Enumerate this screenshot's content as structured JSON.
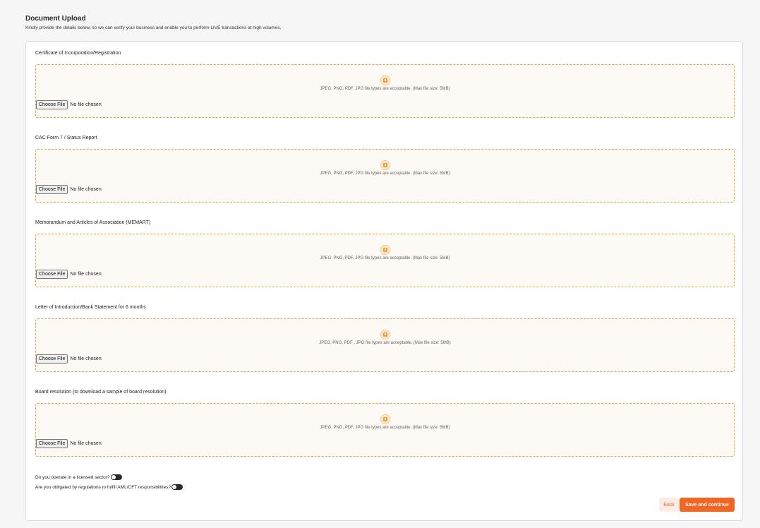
{
  "header": {
    "title": "Document Upload",
    "subtitle": "Kindly provide the details below, so we can verify your business and enable you to perform LIVE transactions at high volumes."
  },
  "documents": [
    {
      "label": "Certificate of Incorporation/Registration",
      "hint": "JPEG, PNG, PDF, JPG file types are acceptable. (Max file size: 5MB)",
      "choose_label": "Choose File",
      "file_status": "No file chosen",
      "icon": "upload-file-icon"
    },
    {
      "label": "CAC Form 7 / Status Report",
      "hint": "JPEG, PNG, PDF, JPG file types are acceptable. (Max file size: 5MB)",
      "choose_label": "Choose File",
      "file_status": "No file chosen",
      "icon": "upload-file-icon"
    },
    {
      "label": "Memorandum and Articles of Association (MEMART)",
      "hint": "JPEG, PNG, PDF, JPG file types are acceptable. (Max file size: 5MB)",
      "choose_label": "Choose File",
      "file_status": "No file chosen",
      "icon": "upload-file-icon"
    },
    {
      "label": "Letter of Introduction/Bank Statement for 6 months",
      "hint": "JPEG, PNG, PDF , JPG file types are acceptable. (Max file size: 5MB)",
      "choose_label": "Choose File",
      "file_status": "No file chosen",
      "icon": "upload-file-icon"
    },
    {
      "label": "Board resolution (to download a sample of board resolution)",
      "hint": "JPEG, PNG, PDF, JPG file types are acceptable. (Max file size: 5MB)",
      "choose_label": "Choose File",
      "file_status": "No file chosen",
      "icon": "upload-file-icon"
    }
  ],
  "questions": [
    {
      "label": "Do you operate in a licensed sector?",
      "checked": false
    },
    {
      "label": "Are you obligated by regulations to fulfill AML/CFT responsibilities?",
      "checked": false
    }
  ],
  "actions": {
    "back_label": "Back",
    "save_label": "Save and continue"
  },
  "colors": {
    "accent": "#f26522",
    "dropzone_border": "#e3a443",
    "dropzone_bg": "#fdf9f4"
  }
}
